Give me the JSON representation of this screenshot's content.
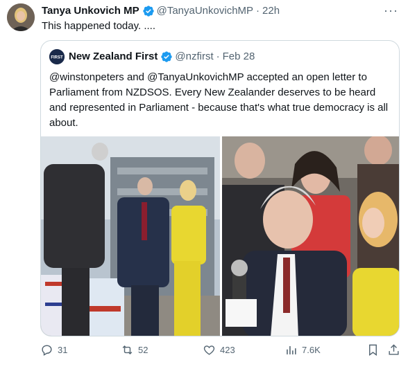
{
  "author": {
    "name": "Tanya Unkovich MP",
    "handle": "@TanyaUnkovichMP",
    "time": "22h",
    "separator": "·",
    "more_icon": "more-dots-icon"
  },
  "tweet": {
    "text": "This happened today. ...."
  },
  "quoted": {
    "name": "New Zealand First",
    "handle": "@nzfirst",
    "time": "Feb 28",
    "separator": "·",
    "avatar_text": "FIRST",
    "text": "@winstonpeters and @TanyaUnkovichMP accepted an open letter to Parliament from NZDSOS. Every New Zealander deserves to be heard and represented in Parliament - because that's what true democracy is all about.",
    "media_icon": "photo-icon"
  },
  "actions": {
    "replies": "31",
    "reposts": "52",
    "likes": "423",
    "views": "7.6K"
  },
  "colors": {
    "verified": "#1d9bf0",
    "secondary_text": "#536471",
    "border": "#cfd9de",
    "suit_yellow": "#e8d730"
  }
}
